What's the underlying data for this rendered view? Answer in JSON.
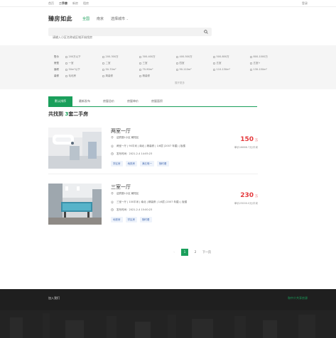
{
  "topbar": {
    "nav": [
      "首页",
      "二手房",
      "新房",
      "租房"
    ],
    "active_index": 1,
    "login": "登录"
  },
  "header": {
    "logo": "臻房如此",
    "city_tabs": [
      "全国",
      "南京",
      "选择城市"
    ],
    "active_city_index": 0,
    "search_placeholder": "请输入小区名称或区域开始找房"
  },
  "filters": {
    "rows": [
      {
        "label": "售价",
        "options": [
          "200万以下",
          "200-300万",
          "300-400万",
          "400-500万",
          "500-800万",
          "800-1000万"
        ]
      },
      {
        "label": "房型",
        "options": [
          "一室",
          "二室",
          "三室",
          "四室",
          "五室",
          "五室+"
        ]
      },
      {
        "label": "面积",
        "options": [
          "50m²以下",
          "50-70m²",
          "70-90m²",
          "90-110m²",
          "110-130m²",
          "130-150m²"
        ]
      },
      {
        "label": "装修",
        "options": [
          "毛坯房",
          "简装修",
          "精装修"
        ]
      }
    ],
    "more": "展开更多"
  },
  "sort_tabs": [
    "默认排序",
    "最新发布",
    "房屋总价",
    "房屋单价",
    "房屋面积"
  ],
  "active_sort_index": 0,
  "result": {
    "prefix": "共找到",
    "count": "3",
    "suffix": "套二手房"
  },
  "listings": [
    {
      "name": "两室一厅",
      "community": "迎宾路1小区 朝阳区",
      "info": "两室一厅 | 90平米 | 南北 | 精装修 | 1/6层 (2007 年建) | 板楼",
      "time": "发布时间：2021-2-4 14:05:23",
      "tags": [
        "学区房",
        "地铁房",
        "满五唯一",
        "随时看"
      ],
      "price": "150",
      "price_unit": "万",
      "unit_price": "单价16666.7元/平米"
    },
    {
      "name": "三室一厅",
      "community": "迎宾路1小区 朝阳区",
      "info": "三室一厅 | 100平米 | 南北 | 精装修 | 1/6层 (2007 年建) | 板楼",
      "time": "发布时间：2021-2-4 15:00:23",
      "tags": [
        "地铁房",
        "学区房",
        "随时看"
      ],
      "price": "230",
      "price_unit": "万",
      "unit_price": "单价23000.0元/平米"
    }
  ],
  "pager": {
    "prev": "‹",
    "pages": [
      "1",
      "2"
    ],
    "active": "1",
    "next": "下一页"
  },
  "footer": {
    "join": "加入我们",
    "friend": "和中介共享房源"
  },
  "colors": {
    "brand": "#1a9f5b",
    "price": "#e4393c",
    "tag": "#4a6fb3"
  }
}
